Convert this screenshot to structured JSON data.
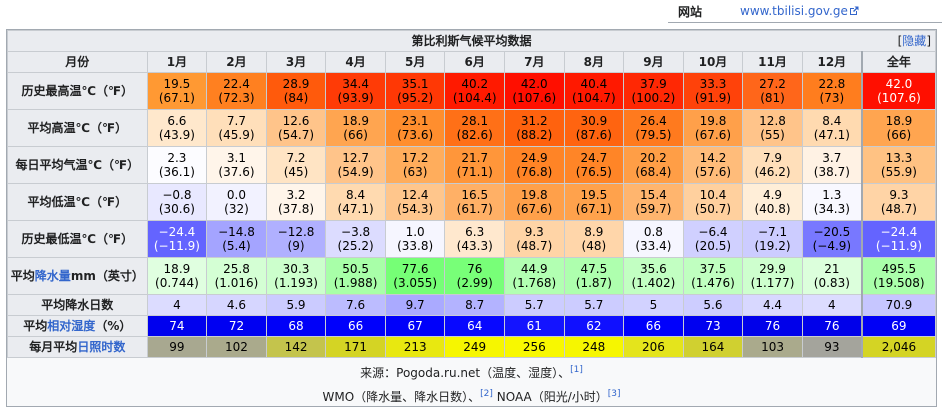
{
  "website": {
    "label": "网站",
    "url": "www.tbilisi.gov.ge"
  },
  "title": "第比利斯气候平均数据",
  "hide_link": "隐藏",
  "header": {
    "corner": "月份",
    "months": [
      "1月",
      "2月",
      "3月",
      "4月",
      "5月",
      "6月",
      "7月",
      "8月",
      "9月",
      "10月",
      "11月",
      "12月"
    ],
    "year": "全年"
  },
  "rows": [
    {
      "label": "历史最高温℃（℉）",
      "link": "",
      "label_suffix": "",
      "cells": [
        {
          "t": "19.5",
          "s": "(67.1)",
          "bg": "#ff9933",
          "fg": "#000000"
        },
        {
          "t": "22.4",
          "s": "(72.3)",
          "bg": "#ff8020",
          "fg": "#000000"
        },
        {
          "t": "28.9",
          "s": "(84)",
          "bg": "#ff5a0c",
          "fg": "#000000"
        },
        {
          "t": "34.4",
          "s": "(93.9)",
          "bg": "#ff3b06",
          "fg": "#000000"
        },
        {
          "t": "35.1",
          "s": "(95.2)",
          "bg": "#ff3805",
          "fg": "#000000"
        },
        {
          "t": "40.2",
          "s": "(104.4)",
          "bg": "#ff1a00",
          "fg": "#000000"
        },
        {
          "t": "42.0",
          "s": "(107.6)",
          "bg": "#ff0f00",
          "fg": "#000000"
        },
        {
          "t": "40.4",
          "s": "(104.7)",
          "bg": "#ff1900",
          "fg": "#000000"
        },
        {
          "t": "37.9",
          "s": "(100.2)",
          "bg": "#ff2804",
          "fg": "#000000"
        },
        {
          "t": "33.3",
          "s": "(91.9)",
          "bg": "#ff420a",
          "fg": "#000000"
        },
        {
          "t": "27.2",
          "s": "(81)",
          "bg": "#ff661a",
          "fg": "#000000"
        },
        {
          "t": "22.8",
          "s": "(73)",
          "bg": "#ff7d1e",
          "fg": "#000000"
        }
      ],
      "total": {
        "t": "42.0",
        "s": "(107.6)",
        "bg": "#ff0f00",
        "fg": "#ffffff"
      }
    },
    {
      "label": "平均高温℃（℉）",
      "link": "",
      "label_suffix": "",
      "cells": [
        {
          "t": "6.6",
          "s": "(43.9)",
          "bg": "#ffe8cc",
          "fg": "#000000"
        },
        {
          "t": "7.7",
          "s": "(45.9)",
          "bg": "#ffdfba",
          "fg": "#000000"
        },
        {
          "t": "12.6",
          "s": "(54.7)",
          "bg": "#ffc48a",
          "fg": "#000000"
        },
        {
          "t": "18.9",
          "s": "(66)",
          "bg": "#ffa550",
          "fg": "#000000"
        },
        {
          "t": "23.1",
          "s": "(73.6)",
          "bg": "#ff8e2e",
          "fg": "#000000"
        },
        {
          "t": "28.1",
          "s": "(82.6)",
          "bg": "#ff7017",
          "fg": "#000000"
        },
        {
          "t": "31.2",
          "s": "(88.2)",
          "bg": "#ff620e",
          "fg": "#000000"
        },
        {
          "t": "30.9",
          "s": "(87.6)",
          "bg": "#ff6410",
          "fg": "#000000"
        },
        {
          "t": "26.4",
          "s": "(79.5)",
          "bg": "#ff7a1e",
          "fg": "#000000"
        },
        {
          "t": "19.8",
          "s": "(67.6)",
          "bg": "#ffa04a",
          "fg": "#000000"
        },
        {
          "t": "12.8",
          "s": "(55)",
          "bg": "#ffc48a",
          "fg": "#000000"
        },
        {
          "t": "8.4",
          "s": "(47.1)",
          "bg": "#ffdab0",
          "fg": "#000000"
        }
      ],
      "total": {
        "t": "18.9",
        "s": "(66)",
        "bg": "#ffa550",
        "fg": "#000000"
      }
    },
    {
      "label": "每日平均气温℃（℉）",
      "link": "",
      "label_suffix": "",
      "cells": [
        {
          "t": "2.3",
          "s": "(36.1)",
          "bg": "#fcfcff",
          "fg": "#000000"
        },
        {
          "t": "3.1",
          "s": "(37.6)",
          "bg": "#fff5ea",
          "fg": "#000000"
        },
        {
          "t": "7.2",
          "s": "(45)",
          "bg": "#ffe4c4",
          "fg": "#000000"
        },
        {
          "t": "12.7",
          "s": "(54.9)",
          "bg": "#ffc48a",
          "fg": "#000000"
        },
        {
          "t": "17.2",
          "s": "(63)",
          "bg": "#ffad5c",
          "fg": "#000000"
        },
        {
          "t": "21.7",
          "s": "(71.1)",
          "bg": "#ff963a",
          "fg": "#000000"
        },
        {
          "t": "24.9",
          "s": "(76.8)",
          "bg": "#ff8426",
          "fg": "#000000"
        },
        {
          "t": "24.7",
          "s": "(76.5)",
          "bg": "#ff8527",
          "fg": "#000000"
        },
        {
          "t": "20.2",
          "s": "(68.4)",
          "bg": "#ff9e46",
          "fg": "#000000"
        },
        {
          "t": "14.2",
          "s": "(57.6)",
          "bg": "#ffbc7a",
          "fg": "#000000"
        },
        {
          "t": "7.9",
          "s": "(46.2)",
          "bg": "#ffdfba",
          "fg": "#000000"
        },
        {
          "t": "3.7",
          "s": "(38.7)",
          "bg": "#fff2e4",
          "fg": "#000000"
        }
      ],
      "total": {
        "t": "13.3",
        "s": "(55.9)",
        "bg": "#ffc283",
        "fg": "#000000"
      }
    },
    {
      "label": "平均低温℃（℉）",
      "link": "",
      "label_suffix": "",
      "cells": [
        {
          "t": "−0.8",
          "s": "(30.6)",
          "bg": "#e8e8ff",
          "fg": "#000000"
        },
        {
          "t": "0.0",
          "s": "(32)",
          "bg": "#f2f2ff",
          "fg": "#000000"
        },
        {
          "t": "3.2",
          "s": "(37.8)",
          "bg": "#fff5ea",
          "fg": "#000000"
        },
        {
          "t": "8.4",
          "s": "(47.1)",
          "bg": "#ffdab0",
          "fg": "#000000"
        },
        {
          "t": "12.4",
          "s": "(54.3)",
          "bg": "#ffc68c",
          "fg": "#000000"
        },
        {
          "t": "16.5",
          "s": "(61.7)",
          "bg": "#ffb066",
          "fg": "#000000"
        },
        {
          "t": "19.8",
          "s": "(67.6)",
          "bg": "#ffa04a",
          "fg": "#000000"
        },
        {
          "t": "19.5",
          "s": "(67.1)",
          "bg": "#ffa24c",
          "fg": "#000000"
        },
        {
          "t": "15.4",
          "s": "(59.7)",
          "bg": "#ffb56e",
          "fg": "#000000"
        },
        {
          "t": "10.4",
          "s": "(50.7)",
          "bg": "#ffd09e",
          "fg": "#000000"
        },
        {
          "t": "4.9",
          "s": "(40.8)",
          "bg": "#ffeed8",
          "fg": "#000000"
        },
        {
          "t": "1.3",
          "s": "(34.3)",
          "bg": "#f8f8ff",
          "fg": "#000000"
        }
      ],
      "total": {
        "t": "9.3",
        "s": "(48.7)",
        "bg": "#ffd4a6",
        "fg": "#000000"
      }
    },
    {
      "label": "历史最低温℃（℉）",
      "link": "",
      "label_suffix": "",
      "cells": [
        {
          "t": "−24.4",
          "s": "(−11.9)",
          "bg": "#6464ff",
          "fg": "#ffffff"
        },
        {
          "t": "−14.8",
          "s": "(5.4)",
          "bg": "#a4a4ff",
          "fg": "#000000"
        },
        {
          "t": "−12.8",
          "s": "(9)",
          "bg": "#b0b0ff",
          "fg": "#000000"
        },
        {
          "t": "−3.8",
          "s": "(25.2)",
          "bg": "#dcdcff",
          "fg": "#000000"
        },
        {
          "t": "1.0",
          "s": "(33.8)",
          "bg": "#f6f6ff",
          "fg": "#000000"
        },
        {
          "t": "6.3",
          "s": "(43.3)",
          "bg": "#ffe8ce",
          "fg": "#000000"
        },
        {
          "t": "9.3",
          "s": "(48.7)",
          "bg": "#ffd4a6",
          "fg": "#000000"
        },
        {
          "t": "8.9",
          "s": "(48)",
          "bg": "#ffd6aa",
          "fg": "#000000"
        },
        {
          "t": "0.8",
          "s": "(33.4)",
          "bg": "#f6f6ff",
          "fg": "#000000"
        },
        {
          "t": "−6.4",
          "s": "(20.5)",
          "bg": "#d0d0ff",
          "fg": "#000000"
        },
        {
          "t": "−7.1",
          "s": "(19.2)",
          "bg": "#ccccff",
          "fg": "#000000"
        },
        {
          "t": "−20.5",
          "s": "(−4.9)",
          "bg": "#7878ff",
          "fg": "#000000"
        }
      ],
      "total": {
        "t": "−24.4",
        "s": "(−11.9)",
        "bg": "#6464ff",
        "fg": "#ffffff"
      }
    },
    {
      "label": "平均",
      "link": "降水量",
      "label_suffix": "mm（英寸）",
      "cells": [
        {
          "t": "18.9",
          "s": "(0.744)",
          "bg": "#e0ffe0",
          "fg": "#000000"
        },
        {
          "t": "25.8",
          "s": "(1.016)",
          "bg": "#d4ffd4",
          "fg": "#000000"
        },
        {
          "t": "30.3",
          "s": "(1.193)",
          "bg": "#ccffcc",
          "fg": "#000000"
        },
        {
          "t": "50.5",
          "s": "(1.988)",
          "bg": "#a8ffa8",
          "fg": "#000000"
        },
        {
          "t": "77.6",
          "s": "(3.055)",
          "bg": "#76ff76",
          "fg": "#000000"
        },
        {
          "t": "76",
          "s": "(2.99)",
          "bg": "#78ff78",
          "fg": "#000000"
        },
        {
          "t": "44.9",
          "s": "(1.768)",
          "bg": "#b2ffb2",
          "fg": "#000000"
        },
        {
          "t": "47.5",
          "s": "(1.87)",
          "bg": "#aeffae",
          "fg": "#000000"
        },
        {
          "t": "35.6",
          "s": "(1.402)",
          "bg": "#c2ffc2",
          "fg": "#000000"
        },
        {
          "t": "37.5",
          "s": "(1.476)",
          "bg": "#c0ffc0",
          "fg": "#000000"
        },
        {
          "t": "29.9",
          "s": "(1.177)",
          "bg": "#ceffce",
          "fg": "#000000"
        },
        {
          "t": "21",
          "s": "(0.83)",
          "bg": "#dcffdc",
          "fg": "#000000"
        }
      ],
      "total": {
        "t": "495.5",
        "s": "(19.508)",
        "bg": "#aaffaa",
        "fg": "#000000"
      }
    },
    {
      "label": "平均降水日数",
      "link": "",
      "label_suffix": "",
      "cells": [
        {
          "t": "4",
          "s": "",
          "bg": "#dcdcff",
          "fg": "#000000"
        },
        {
          "t": "4.6",
          "s": "",
          "bg": "#d6d6ff",
          "fg": "#000000"
        },
        {
          "t": "5.9",
          "s": "",
          "bg": "#cbcbff",
          "fg": "#000000"
        },
        {
          "t": "7.6",
          "s": "",
          "bg": "#bcbcff",
          "fg": "#000000"
        },
        {
          "t": "9.7",
          "s": "",
          "bg": "#aaaaff",
          "fg": "#000000"
        },
        {
          "t": "8.7",
          "s": "",
          "bg": "#b3b3ff",
          "fg": "#000000"
        },
        {
          "t": "5.7",
          "s": "",
          "bg": "#ccccff",
          "fg": "#000000"
        },
        {
          "t": "5.7",
          "s": "",
          "bg": "#ccccff",
          "fg": "#000000"
        },
        {
          "t": "5",
          "s": "",
          "bg": "#d2d2ff",
          "fg": "#000000"
        },
        {
          "t": "5.6",
          "s": "",
          "bg": "#cdcdff",
          "fg": "#000000"
        },
        {
          "t": "4.4",
          "s": "",
          "bg": "#d8d8ff",
          "fg": "#000000"
        },
        {
          "t": "4",
          "s": "",
          "bg": "#dcdcff",
          "fg": "#000000"
        }
      ],
      "total": {
        "t": "70.9",
        "s": "",
        "bg": "#c6c6ff",
        "fg": "#000000"
      }
    },
    {
      "label": "平均",
      "link": "相对湿度",
      "label_suffix": "（%）",
      "cells": [
        {
          "t": "74",
          "s": "",
          "bg": "#0000ee",
          "fg": "#ffffff"
        },
        {
          "t": "72",
          "s": "",
          "bg": "#0000f2",
          "fg": "#ffffff"
        },
        {
          "t": "68",
          "s": "",
          "bg": "#0000f8",
          "fg": "#ffffff"
        },
        {
          "t": "66",
          "s": "",
          "bg": "#0000fc",
          "fg": "#ffffff"
        },
        {
          "t": "67",
          "s": "",
          "bg": "#0000fa",
          "fg": "#ffffff"
        },
        {
          "t": "64",
          "s": "",
          "bg": "#0808ff",
          "fg": "#ffffff"
        },
        {
          "t": "61",
          "s": "",
          "bg": "#1414ff",
          "fg": "#ffffff"
        },
        {
          "t": "62",
          "s": "",
          "bg": "#1010ff",
          "fg": "#ffffff"
        },
        {
          "t": "66",
          "s": "",
          "bg": "#0000fc",
          "fg": "#ffffff"
        },
        {
          "t": "73",
          "s": "",
          "bg": "#0000f0",
          "fg": "#ffffff"
        },
        {
          "t": "76",
          "s": "",
          "bg": "#0000ea",
          "fg": "#ffffff"
        },
        {
          "t": "76",
          "s": "",
          "bg": "#0000ea",
          "fg": "#ffffff"
        }
      ],
      "total": {
        "t": "69",
        "s": "",
        "bg": "#0000f6",
        "fg": "#ffffff"
      }
    },
    {
      "label": "每月平均",
      "link": "日照时数",
      "label_suffix": "",
      "cells": [
        {
          "t": "99",
          "s": "",
          "bg": "#a8a890",
          "fg": "#000000"
        },
        {
          "t": "102",
          "s": "",
          "bg": "#aaaa8c",
          "fg": "#000000"
        },
        {
          "t": "142",
          "s": "",
          "bg": "#c4c44c",
          "fg": "#000000"
        },
        {
          "t": "171",
          "s": "",
          "bg": "#d4d424",
          "fg": "#000000"
        },
        {
          "t": "213",
          "s": "",
          "bg": "#e8e810",
          "fg": "#000000"
        },
        {
          "t": "249",
          "s": "",
          "bg": "#f6f600",
          "fg": "#000000"
        },
        {
          "t": "256",
          "s": "",
          "bg": "#f8f800",
          "fg": "#000000"
        },
        {
          "t": "248",
          "s": "",
          "bg": "#f6f600",
          "fg": "#000000"
        },
        {
          "t": "206",
          "s": "",
          "bg": "#e4e41c",
          "fg": "#000000"
        },
        {
          "t": "164",
          "s": "",
          "bg": "#d0d030",
          "fg": "#000000"
        },
        {
          "t": "103",
          "s": "",
          "bg": "#aaaa8c",
          "fg": "#000000"
        },
        {
          "t": "93",
          "s": "",
          "bg": "#a4a49c",
          "fg": "#000000"
        }
      ],
      "total": {
        "t": "2,046",
        "s": "",
        "bg": "#d4d424",
        "fg": "#000000"
      }
    }
  ],
  "sources": {
    "line1": {
      "text": "来源：Pogoda.ru.net（温度、湿度）、",
      "ref": "[1]"
    },
    "line2": {
      "text1": "WMO（降水量、降水日数）、",
      "ref1": "[2]",
      "text2": " NOAA（阳光/小时）",
      "ref2": "[3]"
    }
  }
}
